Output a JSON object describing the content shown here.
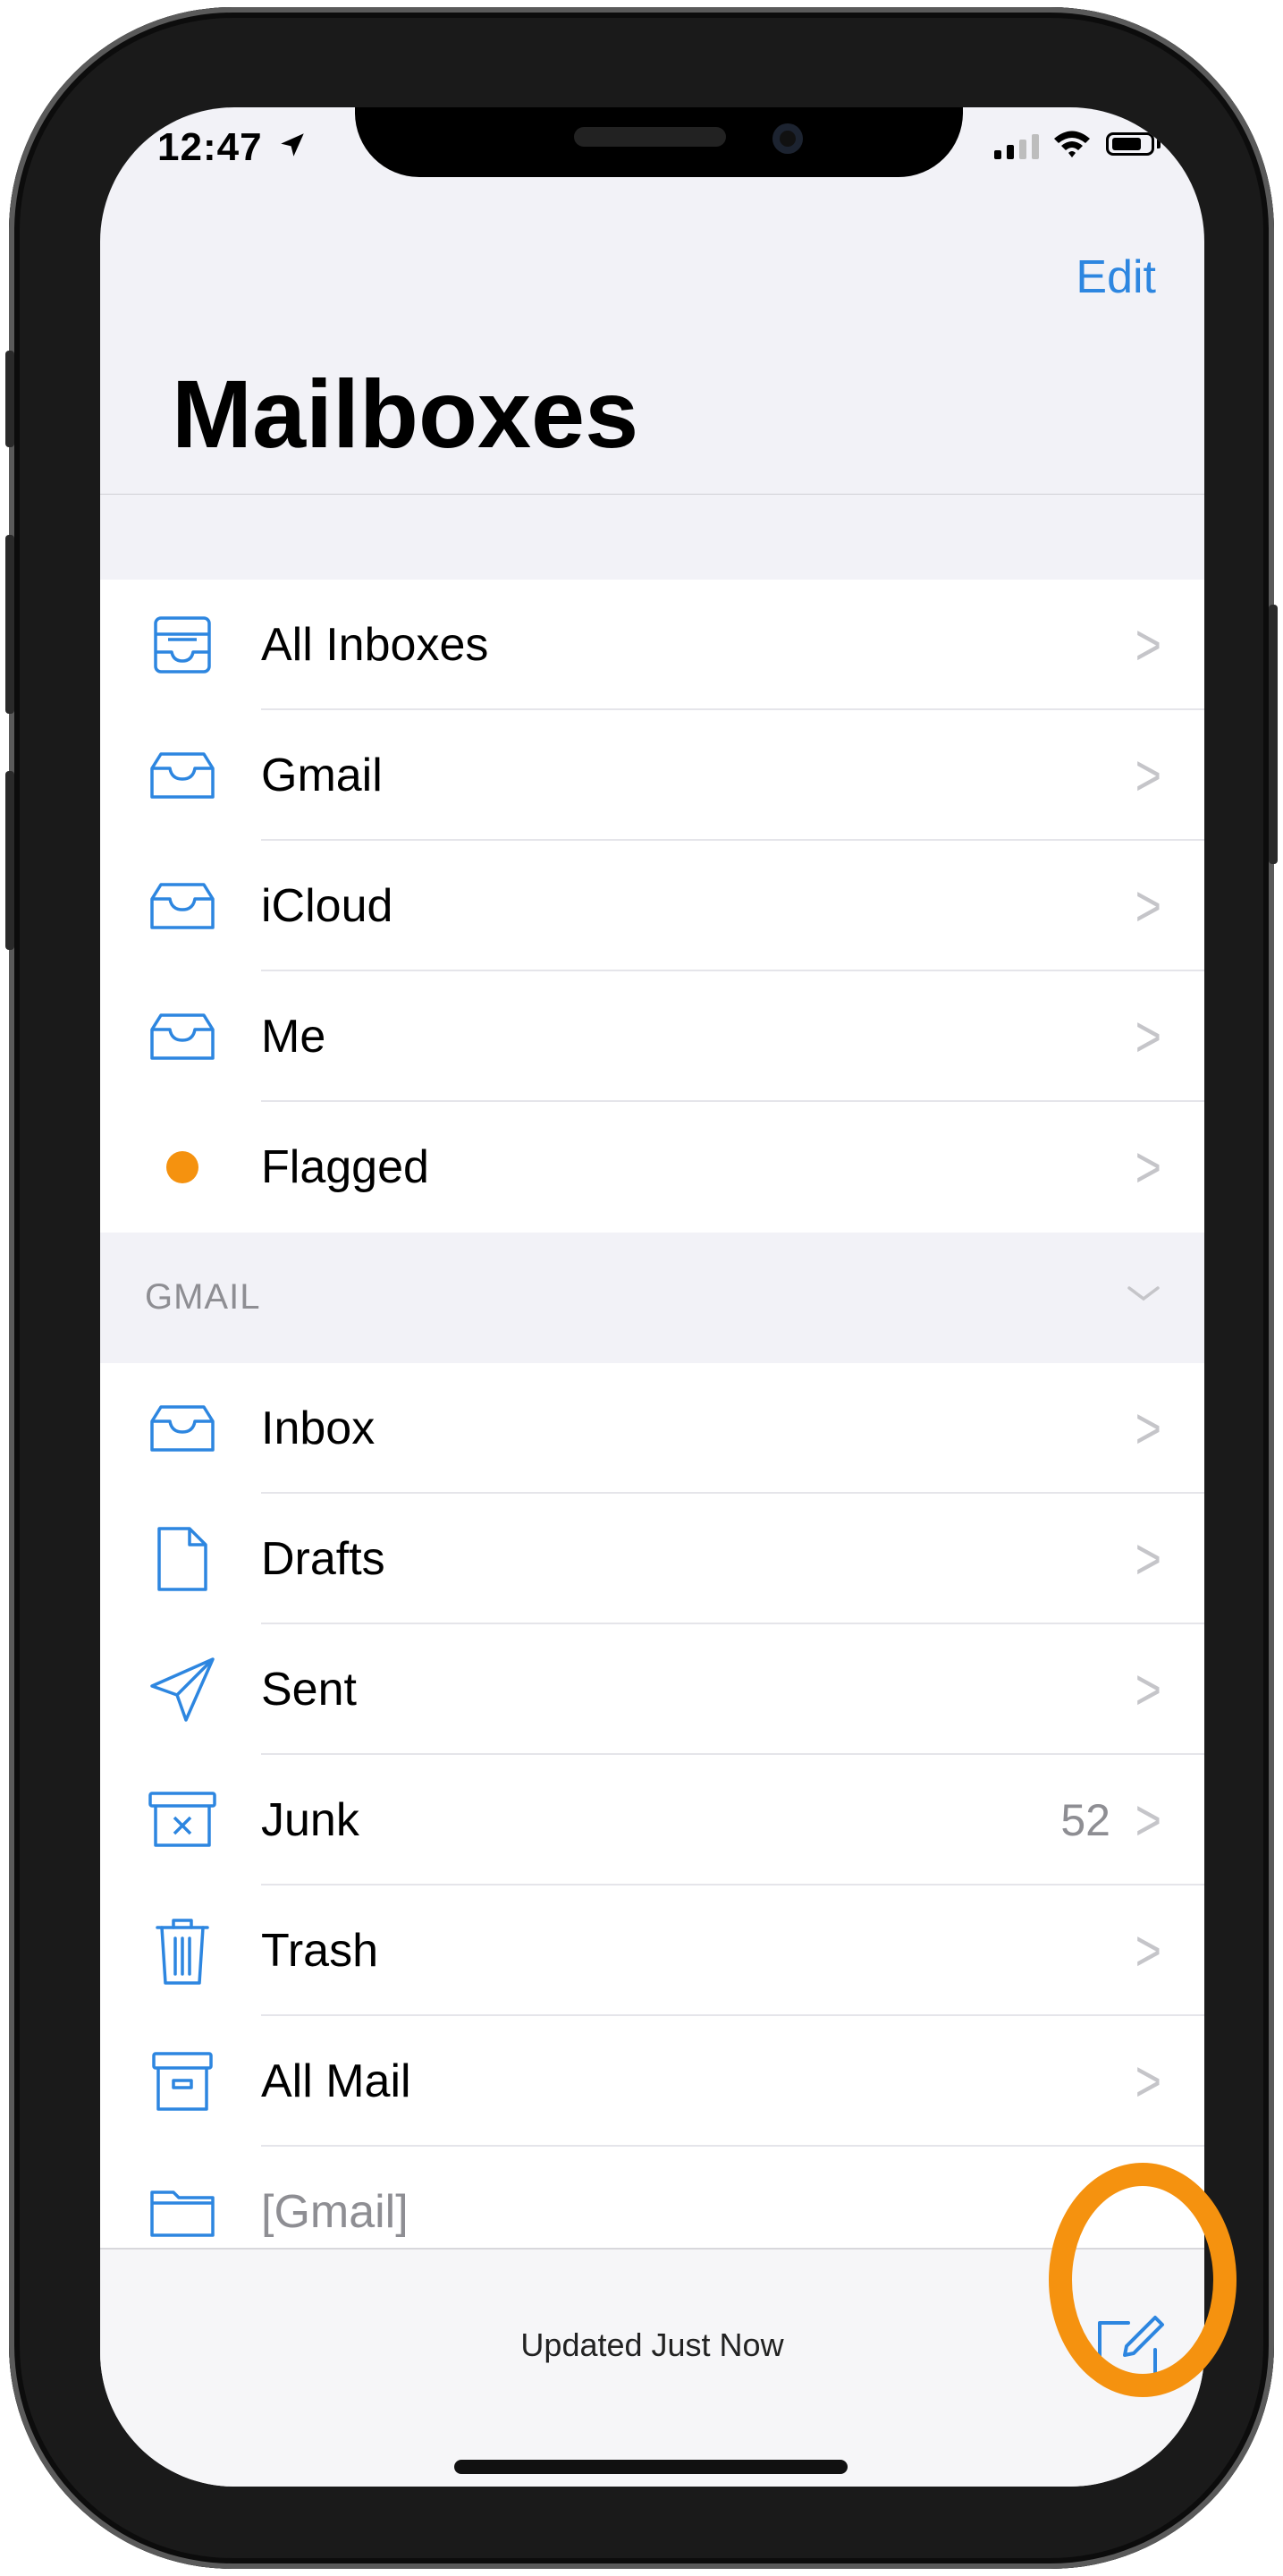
{
  "status_bar": {
    "time": "12:47"
  },
  "nav": {
    "edit_label": "Edit"
  },
  "page": {
    "title": "Mailboxes"
  },
  "favorites": [
    {
      "label": "All Inboxes",
      "icon": "all-inboxes-icon"
    },
    {
      "label": "Gmail",
      "icon": "inbox-tray-icon"
    },
    {
      "label": "iCloud",
      "icon": "inbox-tray-icon"
    },
    {
      "label": "Me",
      "icon": "inbox-tray-icon"
    },
    {
      "label": "Flagged",
      "icon": "flag-dot-icon"
    }
  ],
  "gmail_section": {
    "header": "GMAIL",
    "items": [
      {
        "label": "Inbox",
        "icon": "inbox-tray-icon"
      },
      {
        "label": "Drafts",
        "icon": "document-icon"
      },
      {
        "label": "Sent",
        "icon": "paper-plane-icon"
      },
      {
        "label": "Junk",
        "icon": "junk-icon",
        "count": "52"
      },
      {
        "label": "Trash",
        "icon": "trash-icon"
      },
      {
        "label": "All Mail",
        "icon": "archive-box-icon"
      },
      {
        "label": "[Gmail]",
        "icon": "folder-icon"
      }
    ]
  },
  "toolbar": {
    "status": "Updated Just Now"
  },
  "colors": {
    "accent": "#2d86e0",
    "flag": "#f5920f",
    "highlight": "#f5920f"
  }
}
